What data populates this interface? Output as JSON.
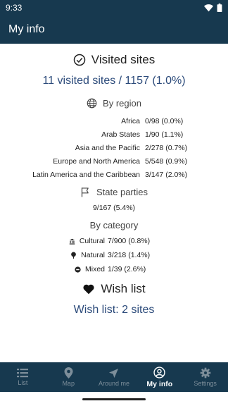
{
  "status_bar": {
    "time": "9:33"
  },
  "app_bar": {
    "title": "My info"
  },
  "visited": {
    "heading": "Visited sites",
    "total": "11 visited sites / 1157 (1.0%)"
  },
  "by_region": {
    "heading": "By region",
    "rows": [
      {
        "label": "Africa",
        "value": "0/98 (0.0%)"
      },
      {
        "label": "Arab States",
        "value": "1/90 (1.1%)"
      },
      {
        "label": "Asia and the Pacific",
        "value": "2/278 (0.7%)"
      },
      {
        "label": "Europe and North America",
        "value": "5/548 (0.9%)"
      },
      {
        "label": "Latin America and the Caribbean",
        "value": "3/147 (2.0%)"
      }
    ]
  },
  "state_parties": {
    "heading": "State parties",
    "value": "9/167 (5.4%)"
  },
  "by_category": {
    "heading": "By category",
    "rows": [
      {
        "label": "Cultural",
        "value": "7/900 (0.8%)",
        "icon": "cultural-icon"
      },
      {
        "label": "Natural",
        "value": "3/218 (1.4%)",
        "icon": "natural-icon"
      },
      {
        "label": "Mixed",
        "value": "1/39 (2.6%)",
        "icon": "mixed-icon"
      }
    ]
  },
  "wish_list": {
    "heading": "Wish list",
    "total": "Wish list: 2 sites"
  },
  "bottom_nav": {
    "items": [
      {
        "label": "List",
        "icon": "list-icon"
      },
      {
        "label": "Map",
        "icon": "map-pin-icon"
      },
      {
        "label": "Around me",
        "icon": "navigation-icon"
      },
      {
        "label": "My info",
        "icon": "account-icon",
        "active": true
      },
      {
        "label": "Settings",
        "icon": "gear-icon"
      }
    ]
  },
  "colors": {
    "primary": "#17394f",
    "accent_text": "#2b4a7a",
    "nav_inactive": "#7d8e9a"
  }
}
